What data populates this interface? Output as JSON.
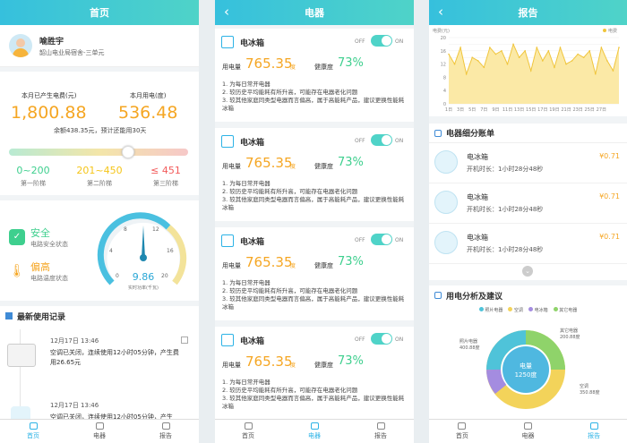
{
  "home": {
    "title": "首页",
    "user": {
      "name": "喻胜宇",
      "address": "韶山电业局宿舍-三单元"
    },
    "stats": {
      "fee_label": "本月已产生电费(元)",
      "fee_value": "1,800.88",
      "usage_label": "本月用电(度)",
      "usage_value": "536.48",
      "balance_text": "余额438.35元，预计还能用30天"
    },
    "tiers": [
      {
        "range": "0~200",
        "label": "第一阶梯",
        "color": "#3ecf8e"
      },
      {
        "range": "201~450",
        "label": "第二阶梯",
        "color": "#f5c518"
      },
      {
        "range": "≤ 451",
        "label": "第三阶梯",
        "color": "#f25b5b"
      }
    ],
    "status": [
      {
        "value": "安全",
        "desc": "电路安全状态",
        "color": "#3ecf8e"
      },
      {
        "value": "偏高",
        "desc": "电路温度状态",
        "color": "#f5a623"
      }
    ],
    "gauge": {
      "value": "9.86",
      "unit": "实时功率(千瓦)",
      "ticks": [
        "0",
        "4",
        "8",
        "12",
        "16",
        "20"
      ],
      "fraction": 0.49
    },
    "records_title": "最新使用记录",
    "records": [
      {
        "time": "12月17日 13:46",
        "text": "空调已关闭，连续使用12小时05分钟，产生费用26.65元"
      },
      {
        "time": "12月17日 13:46",
        "text": "空调已关闭，连续使用12小时05分钟，产生"
      }
    ]
  },
  "appliances": {
    "title": "电器",
    "toggle_off": "OFF",
    "toggle_on": "ON",
    "usage_label": "用电量",
    "usage_unit": "度",
    "health_label": "健康度",
    "items": [
      {
        "name": "电冰箱",
        "usage": "765.35",
        "health": "73%",
        "notes": [
          "1. 为每日常开电器",
          "2. 较历史平均能耗有所升高，可能存在电器老化问题",
          "3. 较其他家庭同类型电器而言偏高，属于高能耗产品，建议更换性能耗冰箱"
        ]
      },
      {
        "name": "电冰箱",
        "usage": "765.35",
        "health": "73%",
        "notes": [
          "1. 为每日常开电器",
          "2. 较历史平均能耗有所升高，可能存在电器老化问题",
          "3. 较其他家庭同类型电器而言偏高，属于高能耗产品，建议更换性能耗冰箱"
        ]
      },
      {
        "name": "电冰箱",
        "usage": "765.35",
        "health": "73%",
        "notes": [
          "1. 为每日常开电器",
          "2. 较历史平均能耗有所升高，可能存在电器老化问题",
          "3. 较其他家庭同类型电器而言偏高，属于高能耗产品，建议更换性能耗冰箱"
        ]
      },
      {
        "name": "电冰箱",
        "usage": "765.35",
        "health": "73%",
        "notes": [
          "1. 为每日常开电器",
          "2. 较历史平均能耗有所升高，可能存在电器老化问题",
          "3. 较其他家庭同类型电器而言偏高，属于高能耗产品，建议更换性能耗冰箱"
        ]
      }
    ]
  },
  "report": {
    "title": "报告",
    "ledger_title": "电器细分账单",
    "ledger": [
      {
        "name": "电冰箱",
        "duration": "开机时长：1小时28分48秒",
        "cost": "¥0.71"
      },
      {
        "name": "电冰箱",
        "duration": "开机时长：1小时28分48秒",
        "cost": "¥0.71"
      },
      {
        "name": "电冰箱",
        "duration": "开机时长：1小时28分48秒",
        "cost": "¥0.71"
      }
    ],
    "analysis_title": "用电分析及建议",
    "donut": {
      "center_label": "电量",
      "center_value": "1250度",
      "legend": [
        {
          "name": "照片电器",
          "color": "#4fc3d9"
        },
        {
          "name": "空调",
          "color": "#f3d35a"
        },
        {
          "name": "电冰箱",
          "color": "#a48ce0"
        },
        {
          "name": "其它电器",
          "color": "#8fd36a"
        }
      ],
      "callouts": [
        {
          "name": "其它电器",
          "value": "200.88度"
        },
        {
          "name": "照片电器",
          "value": "400.88度"
        },
        {
          "name": "空调",
          "value": "350.88度"
        }
      ]
    }
  },
  "tabs": [
    {
      "label": "首页",
      "icon": "home-icon"
    },
    {
      "label": "电器",
      "icon": "appliance-icon"
    },
    {
      "label": "报告",
      "icon": "report-icon"
    }
  ],
  "chart_data": {
    "type": "area",
    "ylabel": "电费(元)",
    "legend": [
      "电费"
    ],
    "ylim": [
      0,
      20
    ],
    "yticks": [
      "0",
      "2",
      "4",
      "6",
      "8",
      "10",
      "12",
      "14",
      "16",
      "18",
      "20"
    ],
    "xticks": [
      "1日",
      "3日",
      "5日",
      "7日",
      "9日",
      "11日",
      "13日",
      "15日",
      "17日",
      "19日",
      "21日",
      "23日",
      "25日",
      "27日"
    ],
    "x": [
      1,
      2,
      3,
      4,
      5,
      6,
      7,
      8,
      9,
      10,
      11,
      12,
      13,
      14,
      15,
      16,
      17,
      18,
      19,
      20,
      21,
      22,
      23,
      24,
      25,
      26,
      27,
      28,
      29,
      30
    ],
    "values": [
      15,
      12,
      17,
      9,
      14,
      13,
      11,
      17,
      15,
      16,
      12,
      18,
      14,
      16,
      10,
      17,
      13,
      16,
      11,
      17,
      12,
      13,
      15,
      14,
      16,
      9,
      17,
      13,
      10,
      17
    ],
    "colors": {
      "fill": "#fbe9a6",
      "line": "#f0c53c"
    }
  }
}
